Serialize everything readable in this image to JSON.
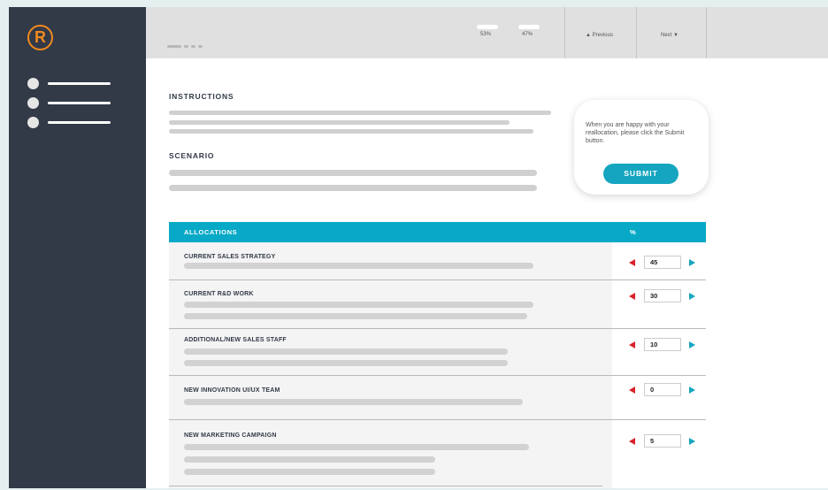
{
  "logo": {
    "letter": "R"
  },
  "topbar": {
    "pct_left": "53%",
    "pct_right": "47%",
    "previous_label": "▲ Previous",
    "next_label": "Next ▼"
  },
  "instructions": {
    "title": "INSTRUCTIONS"
  },
  "scenario": {
    "title": "SCENARIO"
  },
  "card": {
    "text": "When you are happy with your reallocation, please click the Submit button.",
    "submit_label": "SUBMIT"
  },
  "allocations": {
    "header_label": "ALLOCATIONS",
    "header_pct": "%",
    "rows": [
      {
        "label": "CURRENT SALES STRATEGY",
        "value": "45"
      },
      {
        "label": "CURRENT R&D WORK",
        "value": "30"
      },
      {
        "label": "ADDITIONAL/NEW SALES STAFF",
        "value": "10"
      },
      {
        "label": "NEW INNOVATION UI/UX TEAM",
        "value": "0"
      },
      {
        "label": "NEW MARKETING CAMPAIGN",
        "value": "5"
      }
    ]
  },
  "colors": {
    "sidebar": "#323947",
    "accent": "#07a9c7",
    "logo": "#f08a1f",
    "decrease_arrow": "#d8232a",
    "increase_arrow": "#16a5c0"
  }
}
